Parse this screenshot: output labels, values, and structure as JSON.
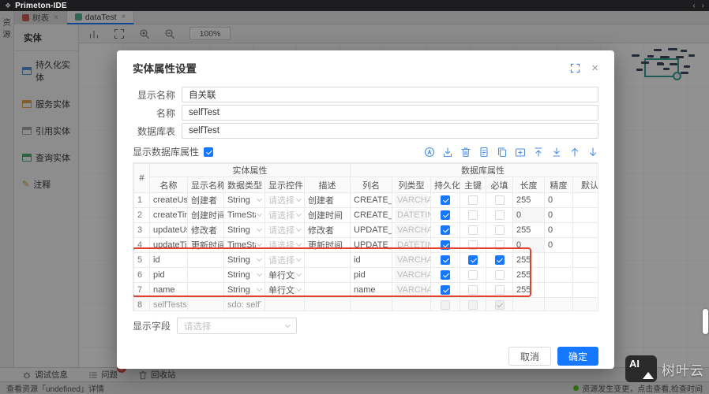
{
  "window": {
    "title": "Primeton-IDE",
    "nav_back": "‹",
    "nav_forward": "›"
  },
  "tabs": [
    {
      "label": "树表",
      "icon": "tree-table-icon",
      "icon_color": "#c4584d",
      "close": "×",
      "active": false
    },
    {
      "label": "dataTest",
      "icon": "entity-file-icon",
      "icon_color": "#57b08a",
      "close": "×",
      "active": true
    }
  ],
  "resource_rail": {
    "label": "资源"
  },
  "sidebar": {
    "title": "实体",
    "items": [
      {
        "label": "持久化实体",
        "icon": "persistent-entity-icon",
        "color": "#4a90d9"
      },
      {
        "label": "服务实体",
        "icon": "service-entity-icon",
        "color": "#e8a33d"
      },
      {
        "label": "引用实体",
        "icon": "reference-entity-icon",
        "color": "#a6a6a6"
      },
      {
        "label": "查询实体",
        "icon": "query-entity-icon",
        "color": "#46a96c"
      },
      {
        "label": "注释",
        "icon": "comment-icon",
        "color": "#d4a018"
      }
    ]
  },
  "canvas_toolbar": {
    "icons": [
      "bar-chart-icon",
      "fit-screen-icon",
      "zoom-in-icon",
      "zoom-out-icon"
    ],
    "zoom_level": "100%"
  },
  "dialog": {
    "title": "实体属性设置",
    "accent_color": "#1677ff",
    "annotation_color": "#e5402d",
    "fields": [
      {
        "key": "display-name",
        "label": "显示名称",
        "value": "自关联"
      },
      {
        "key": "name",
        "label": "名称",
        "value": "selfTest"
      },
      {
        "key": "db-table",
        "label": "数据库表",
        "value": "selfTest"
      }
    ],
    "show_db_props_label": "显示数据库属性",
    "table_toolbar_icons": [
      "auto-name-icon",
      "import-icon",
      "delete-icon",
      "detail-icon",
      "copy-icon",
      "add-folder-icon",
      "move-top-icon",
      "move-bottom-icon",
      "move-up-icon",
      "move-down-icon"
    ],
    "table": {
      "index_header": "#",
      "group_entity": "实体属性",
      "group_database": "数据库属性",
      "columns": [
        "名称",
        "显示名称",
        "数据类型",
        "显示控件",
        "描述",
        "列名",
        "列类型",
        "持久化",
        "主键",
        "必填",
        "长度",
        "精度",
        "默认值"
      ],
      "rows": [
        {
          "num": "1",
          "name": "createUser",
          "display": "创建者",
          "type": {
            "text": "String",
            "dropdown": true
          },
          "widget": {
            "text": "请选择",
            "dropdown": true,
            "placeholder": true
          },
          "desc": "创建者",
          "column": "CREATE_USER",
          "column_type": "VARCHAR",
          "persist": "on",
          "primary_key": "off",
          "required": "off",
          "length": "255",
          "length_disabled": false,
          "precision": "0",
          "default": "",
          "disabled": false
        },
        {
          "num": "2",
          "name": "createTime",
          "display": "创建时间",
          "type": {
            "text": "TimeStamp",
            "dropdown": true
          },
          "widget": {
            "text": "请选择",
            "dropdown": true,
            "placeholder": true
          },
          "desc": "创建时间",
          "column": "CREATE_TIME",
          "column_type": "DATETIME",
          "persist": "on",
          "primary_key": "off",
          "required": "off",
          "length": "0",
          "length_disabled": true,
          "precision": "0",
          "default": "",
          "disabled": false
        },
        {
          "num": "3",
          "name": "updateUser",
          "display": "修改者",
          "type": {
            "text": "String",
            "dropdown": true
          },
          "widget": {
            "text": "请选择",
            "dropdown": true,
            "placeholder": true
          },
          "desc": "修改者",
          "column": "UPDATE_USER",
          "column_type": "VARCHAR",
          "persist": "on",
          "primary_key": "off",
          "required": "off",
          "length": "255",
          "length_disabled": false,
          "precision": "0",
          "default": "",
          "disabled": false
        },
        {
          "num": "4",
          "name": "updateTime",
          "display": "更新时间",
          "type": {
            "text": "TimeStamp",
            "dropdown": true
          },
          "widget": {
            "text": "请选择",
            "dropdown": true,
            "placeholder": true
          },
          "desc": "更新时间",
          "column": "UPDATE_TIME",
          "column_type": "DATETIME",
          "persist": "on",
          "primary_key": "off",
          "required": "off",
          "length": "0",
          "length_disabled": true,
          "precision": "0",
          "default": "",
          "disabled": false
        },
        {
          "num": "5",
          "name": "id",
          "display": "",
          "type": {
            "text": "String",
            "dropdown": true
          },
          "widget": {
            "text": "请选择",
            "dropdown": true,
            "placeholder": true
          },
          "desc": "",
          "column": "id",
          "column_type": "VARCHAR",
          "persist": "on",
          "primary_key": "on",
          "required": "on",
          "length": "255",
          "length_disabled": false,
          "precision": "",
          "default": "",
          "disabled": false
        },
        {
          "num": "6",
          "name": "pid",
          "display": "",
          "type": {
            "text": "String",
            "dropdown": true
          },
          "widget": {
            "text": "单行文本",
            "dropdown": true,
            "placeholder": false
          },
          "desc": "",
          "column": "pid",
          "column_type": "VARCHAR",
          "persist": "on",
          "primary_key": "off",
          "required": "off",
          "length": "255",
          "length_disabled": false,
          "precision": "",
          "default": "",
          "disabled": false
        },
        {
          "num": "7",
          "name": "name",
          "display": "",
          "type": {
            "text": "String",
            "dropdown": true
          },
          "widget": {
            "text": "单行文本",
            "dropdown": true,
            "placeholder": false
          },
          "desc": "",
          "column": "name",
          "column_type": "VARCHAR",
          "persist": "on",
          "primary_key": "off",
          "required": "off",
          "length": "255",
          "length_disabled": false,
          "precision": "",
          "default": "",
          "disabled": false
        },
        {
          "num": "8",
          "name": "selfTests",
          "display": "",
          "type": {
            "text": "sdo: selfTest",
            "dropdown": false
          },
          "widget": {
            "text": "",
            "dropdown": false,
            "placeholder": false
          },
          "desc": "",
          "column": "",
          "column_type": "",
          "persist": "off-disabled",
          "primary_key": "off-disabled",
          "required": "on-disabled",
          "length": "",
          "length_disabled": false,
          "precision": "",
          "default": "",
          "disabled": true
        }
      ]
    },
    "display_field_label": "显示字段",
    "display_field_placeholder": "请选择",
    "cancel_label": "取消",
    "confirm_label": "确定"
  },
  "bottom_bar": {
    "items": [
      {
        "label": "调试信息",
        "icon": "debug-icon",
        "badge": ""
      },
      {
        "label": "问题",
        "icon": "problems-icon",
        "badge": "9"
      },
      {
        "label": "回收站",
        "icon": "recycle-icon",
        "badge": ""
      }
    ]
  },
  "status_bar": {
    "left": "查看资源「undefined」详情",
    "right": "资源发生变更，点击查看,检查时间",
    "dot_color": "#52c41a"
  },
  "watermark": {
    "logo_text": "AI",
    "brand": "树叶云"
  }
}
